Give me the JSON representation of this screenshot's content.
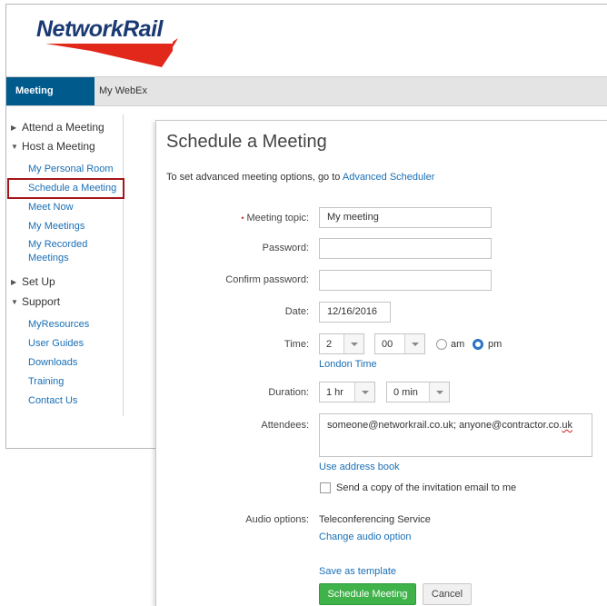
{
  "brand": {
    "logo_text": "NetworkRail",
    "accent_color": "#e2271b",
    "brand_color": "#1b3a73"
  },
  "tabs": [
    {
      "label": "Meeting Center",
      "active": true
    },
    {
      "label": "My WebEx",
      "active": false
    }
  ],
  "sidebar": {
    "attend": "Attend a Meeting",
    "host": "Host a Meeting",
    "host_items": [
      "My Personal Room",
      "Schedule a Meeting",
      "Meet Now",
      "My Meetings",
      "My Recorded",
      "Meetings"
    ],
    "setup": "Set Up",
    "support": "Support",
    "support_items": [
      "MyResources",
      "User Guides",
      "Downloads",
      "Training",
      "Contact Us"
    ]
  },
  "form": {
    "title": "Schedule a Meeting",
    "intro_prefix": "To set advanced meeting options, go to",
    "intro_link": "Advanced Scheduler",
    "topic_label": "Meeting topic:",
    "topic_value": "My meeting",
    "password_label": "Password:",
    "confirm_label": "Confirm password:",
    "date_label": "Date:",
    "date_value": "12/16/2016",
    "time_label": "Time:",
    "hour_value": "2",
    "minute_value": "00",
    "am_label": "am",
    "pm_label": "pm",
    "selected_period": "pm",
    "timezone_link": "London Time",
    "duration_label": "Duration:",
    "duration_hr": "1 hr",
    "duration_min": "0 min",
    "attendees_label": "Attendees:",
    "attendees_main": "someone@networkrail.co.uk; anyone@contractor.co.",
    "attendees_tail": "uk",
    "address_book_link": "Use address book",
    "copy_checkbox_label": "Send a copy of the invitation email to me",
    "copy_checked": false,
    "audio_label": "Audio options:",
    "audio_value": "Teleconferencing Service",
    "audio_link": "Change audio option",
    "template_link": "Save as template",
    "schedule_button": "Schedule Meeting",
    "cancel_button": "Cancel"
  }
}
